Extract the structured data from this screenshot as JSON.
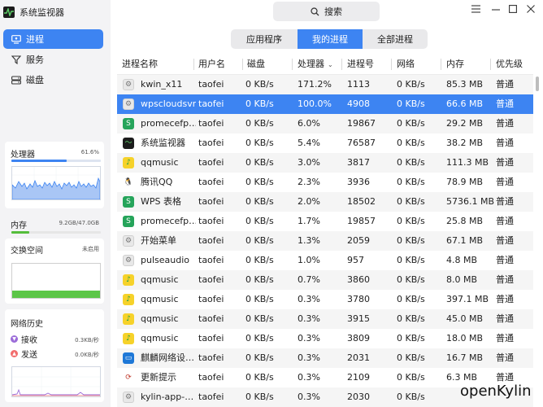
{
  "app": {
    "title": "系统监视器"
  },
  "search": {
    "label": "搜索"
  },
  "nav": [
    {
      "label": "进程",
      "icon": "monitor-icon",
      "active": true
    },
    {
      "label": "服务",
      "icon": "filter-icon",
      "active": false
    },
    {
      "label": "磁盘",
      "icon": "disk-icon",
      "active": false
    }
  ],
  "cpu": {
    "label": "处理器",
    "value": "61.6%",
    "fraction": 0.616
  },
  "memory": {
    "label": "内存",
    "value": "9.2GB/47.0GB",
    "fraction": 0.196
  },
  "swap": {
    "label": "交换空间",
    "value": "未启用"
  },
  "network": {
    "label": "网络历史",
    "recv_label": "接收",
    "recv_value": "0.3KB/秒",
    "send_label": "发送",
    "send_value": "0.0KB/秒"
  },
  "tabs": [
    {
      "label": "应用程序",
      "active": false
    },
    {
      "label": "我的进程",
      "active": true
    },
    {
      "label": "全部进程",
      "active": false
    }
  ],
  "columns": [
    "进程名称",
    "用户名",
    "磁盘",
    "处理器",
    "进程号",
    "网络",
    "内存",
    "优先级"
  ],
  "sort_column": "处理器",
  "processes": [
    {
      "name": "kwin_x11",
      "icon": "gear-icon",
      "user": "taofei",
      "disk": "0 KB/s",
      "cpu": "171.2%",
      "pid": "1113",
      "net": "0 KB/s",
      "mem": "85.3 MB",
      "priority": "普通",
      "selected": false
    },
    {
      "name": "wpscloudsvr",
      "icon": "gear-icon",
      "user": "taofei",
      "disk": "0 KB/s",
      "cpu": "100.0%",
      "pid": "4908",
      "net": "0 KB/s",
      "mem": "66.6 MB",
      "priority": "普通",
      "selected": true
    },
    {
      "name": "promecefp…",
      "icon": "wps-sheet-icon",
      "user": "taofei",
      "disk": "0 KB/s",
      "cpu": "6.0%",
      "pid": "19867",
      "net": "0 KB/s",
      "mem": "29.2 MB",
      "priority": "普通",
      "selected": false
    },
    {
      "name": "系统监视器",
      "icon": "system-monitor-icon",
      "user": "taofei",
      "disk": "0 KB/s",
      "cpu": "5.4%",
      "pid": "76587",
      "net": "0 KB/s",
      "mem": "38.2 MB",
      "priority": "普通",
      "selected": false
    },
    {
      "name": "qqmusic",
      "icon": "qqmusic-icon",
      "user": "taofei",
      "disk": "0 KB/s",
      "cpu": "3.0%",
      "pid": "3817",
      "net": "0 KB/s",
      "mem": "111.3 MB",
      "priority": "普通",
      "selected": false
    },
    {
      "name": "腾讯QQ",
      "icon": "qq-icon",
      "user": "taofei",
      "disk": "0 KB/s",
      "cpu": "2.3%",
      "pid": "3936",
      "net": "0 KB/s",
      "mem": "78.9 MB",
      "priority": "普通",
      "selected": false
    },
    {
      "name": "WPS 表格",
      "icon": "wps-sheet-icon",
      "user": "taofei",
      "disk": "0 KB/s",
      "cpu": "2.0%",
      "pid": "18502",
      "net": "0 KB/s",
      "mem": "5736.1 MB",
      "priority": "普通",
      "selected": false
    },
    {
      "name": "promecefp…",
      "icon": "wps-sheet-icon",
      "user": "taofei",
      "disk": "0 KB/s",
      "cpu": "1.7%",
      "pid": "19857",
      "net": "0 KB/s",
      "mem": "25.8 MB",
      "priority": "普通",
      "selected": false
    },
    {
      "name": "开始菜单",
      "icon": "gear-icon",
      "user": "taofei",
      "disk": "0 KB/s",
      "cpu": "1.3%",
      "pid": "2059",
      "net": "0 KB/s",
      "mem": "67.1 MB",
      "priority": "普通",
      "selected": false
    },
    {
      "name": "pulseaudio",
      "icon": "gear-icon",
      "user": "taofei",
      "disk": "0 KB/s",
      "cpu": "1.0%",
      "pid": "957",
      "net": "0 KB/s",
      "mem": "4.8 MB",
      "priority": "普通",
      "selected": false
    },
    {
      "name": "qqmusic",
      "icon": "qqmusic-icon",
      "user": "taofei",
      "disk": "0 KB/s",
      "cpu": "0.7%",
      "pid": "3860",
      "net": "0 KB/s",
      "mem": "8.0 MB",
      "priority": "普通",
      "selected": false
    },
    {
      "name": "qqmusic",
      "icon": "qqmusic-icon",
      "user": "taofei",
      "disk": "0 KB/s",
      "cpu": "0.3%",
      "pid": "3780",
      "net": "0 KB/s",
      "mem": "397.1 MB",
      "priority": "普通",
      "selected": false
    },
    {
      "name": "qqmusic",
      "icon": "qqmusic-icon",
      "user": "taofei",
      "disk": "0 KB/s",
      "cpu": "0.3%",
      "pid": "3915",
      "net": "0 KB/s",
      "mem": "45.0 MB",
      "priority": "普通",
      "selected": false
    },
    {
      "name": "qqmusic",
      "icon": "qqmusic-icon",
      "user": "taofei",
      "disk": "0 KB/s",
      "cpu": "0.3%",
      "pid": "3809",
      "net": "0 KB/s",
      "mem": "18.0 MB",
      "priority": "普通",
      "selected": false
    },
    {
      "name": "麒麟网络设…",
      "icon": "network-settings-icon",
      "user": "taofei",
      "disk": "0 KB/s",
      "cpu": "0.3%",
      "pid": "2031",
      "net": "0 KB/s",
      "mem": "16.7 MB",
      "priority": "普通",
      "selected": false
    },
    {
      "name": "更新提示",
      "icon": "update-icon",
      "user": "taofei",
      "disk": "0 KB/s",
      "cpu": "0.3%",
      "pid": "2109",
      "net": "0 KB/s",
      "mem": "6.3 MB",
      "priority": "普通",
      "selected": false
    },
    {
      "name": "kylin-app-…",
      "icon": "gear-icon",
      "user": "taofei",
      "disk": "0 KB/s",
      "cpu": "0.3%",
      "pid": "2030",
      "net": "0 KB/s",
      "mem": "",
      "priority": "",
      "selected": false
    }
  ],
  "watermark": "openKylin",
  "colors": {
    "accent": "#3d84f2",
    "memory": "#55bd3b",
    "recv": "#9b6bd8",
    "send": "#f26d6d"
  }
}
